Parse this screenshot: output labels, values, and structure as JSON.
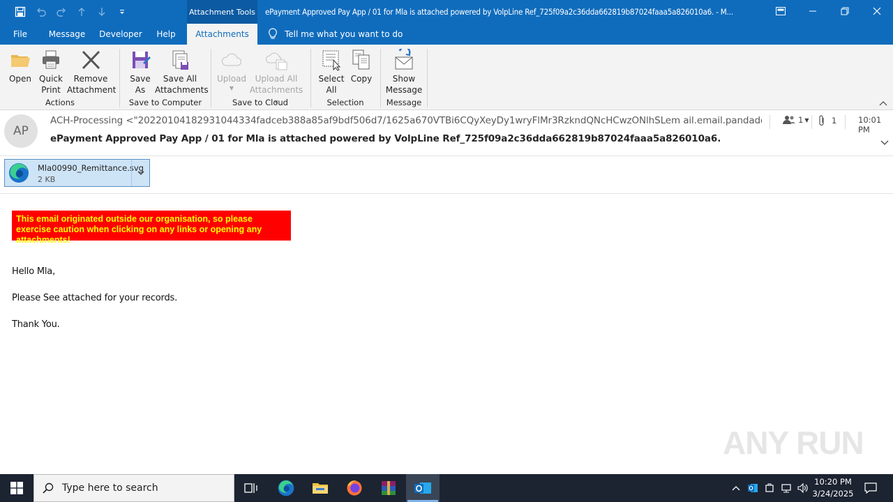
{
  "titlebar": {
    "context_tab": "Attachment Tools",
    "window_title": "ePayment Approved Pay App / 01 for Mla is attached  powered by VolpLine Ref_725f09a2c36dda662819b87024faaa5a826010a6.  -  M..."
  },
  "tabs": {
    "file": "File",
    "message": "Message",
    "developer": "Developer",
    "help": "Help",
    "attachments": "Attachments",
    "tell_me": "Tell me what you want to do"
  },
  "ribbon": {
    "open": "Open",
    "quick_print_1": "Quick",
    "quick_print_2": "Print",
    "remove_1": "Remove",
    "remove_2": "Attachment",
    "save_as_1": "Save",
    "save_as_2": "As",
    "save_all_1": "Save All",
    "save_all_2": "Attachments",
    "upload": "Upload",
    "upload_all_1": "Upload All",
    "upload_all_2": "Attachments",
    "select_all_1": "Select",
    "select_all_2": "All",
    "copy": "Copy",
    "show_message_1": "Show",
    "show_message_2": "Message",
    "groups": {
      "actions": "Actions",
      "save_to_computer": "Save to Computer",
      "save_to_cloud": "Save to Cloud",
      "selection": "Selection",
      "message": "Message"
    }
  },
  "header": {
    "avatar_initials": "AP",
    "from": "ACH-Processing <\"20220104182931044334fadceb388a85af9bdf506d7/1625a670VTBi6CQyXeyDy1wryFlMr3RzkndQNcHCwzONlhSLem ail.email.pandadoc.net",
    "subject": "ePayment Approved Pay App / 01 for Mla is attached  powered by VolpLine Ref_725f09a2c36dda662819b87024faaa5a826010a6.",
    "people_count": "1",
    "attachment_count": "1",
    "time": "10:01 PM"
  },
  "attachment": {
    "name": "Mla00990_Remittance.svg",
    "size": "2 KB"
  },
  "body": {
    "warning": "This email originated outside our organisation, so please exercise caution when clicking on any links or opening any attachments!",
    "greeting": "Hello Mla,",
    "line1": "Please See attached for your records.",
    "closing": "Thank You."
  },
  "watermark": "ANY RUN",
  "taskbar": {
    "search_placeholder": "Type here to search",
    "time": "10:20 PM",
    "date": "3/24/2025"
  },
  "colors": {
    "accent": "#0f6cbd",
    "warning_bg": "#ff0000",
    "warning_fg": "#ffff00",
    "attachment_bg": "#cde4f7"
  }
}
